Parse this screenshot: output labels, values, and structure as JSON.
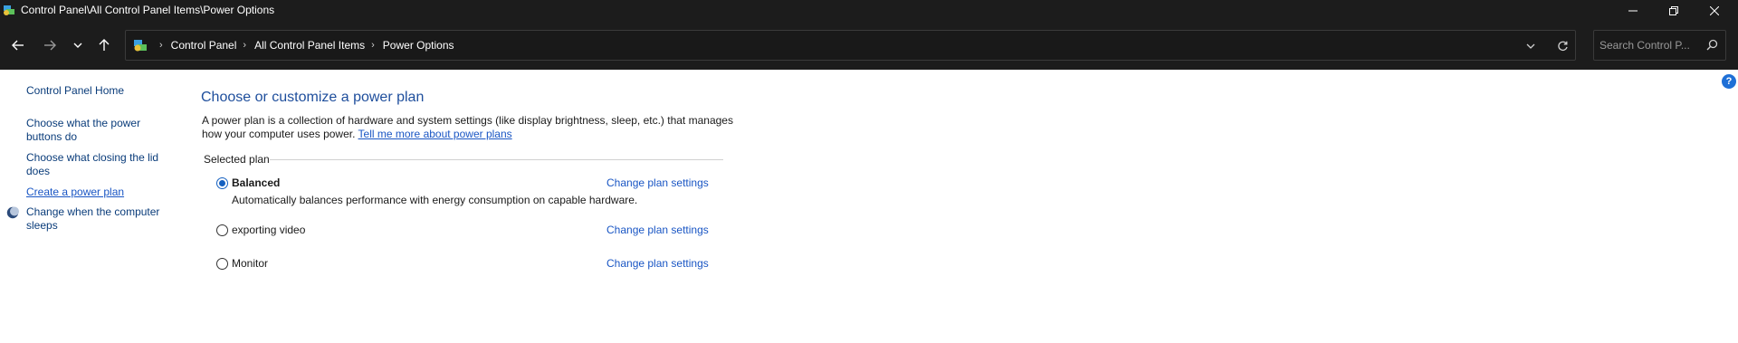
{
  "window": {
    "title": "Control Panel\\All Control Panel Items\\Power Options"
  },
  "address_bar": {
    "breadcrumbs": [
      "Control Panel",
      "All Control Panel Items",
      "Power Options"
    ]
  },
  "search": {
    "placeholder": "Search Control P..."
  },
  "left_pane": {
    "home": "Control Panel Home",
    "power_buttons": "Choose what the power buttons do",
    "closing_lid": "Choose what closing the lid does",
    "create_plan": "Create a power plan",
    "computer_sleeps": "Change when the computer sleeps"
  },
  "main": {
    "heading": "Choose or customize a power plan",
    "description": "A power plan is a collection of hardware and system settings (like display brightness, sleep, etc.) that manages how your computer uses power.",
    "learn_more": "Tell me more about power plans",
    "group_label": "Selected plan",
    "plans": [
      {
        "name": "Balanced",
        "description": "Automatically balances performance with energy consumption on capable hardware.",
        "selected": true,
        "change_label": "Change plan settings"
      },
      {
        "name": "exporting video",
        "selected": false,
        "change_label": "Change plan settings"
      },
      {
        "name": "Monitor",
        "selected": false,
        "change_label": "Change plan settings"
      }
    ]
  },
  "help": {
    "label": "?"
  },
  "colors": {
    "chrome": "#1c1c1c",
    "link": "#1a56c4",
    "heading": "#1e4e9c",
    "accent": "#1560c0"
  },
  "icons": {
    "app": "control-panel-icon",
    "back": "arrow-left-icon",
    "forward": "arrow-right-icon",
    "recent": "chevron-down-icon",
    "up": "arrow-up-icon",
    "refresh": "refresh-icon",
    "search": "search-icon",
    "minimize": "minimize-icon",
    "maximize": "restore-icon",
    "close": "close-icon",
    "sleep": "moon-icon",
    "help": "help-icon"
  }
}
